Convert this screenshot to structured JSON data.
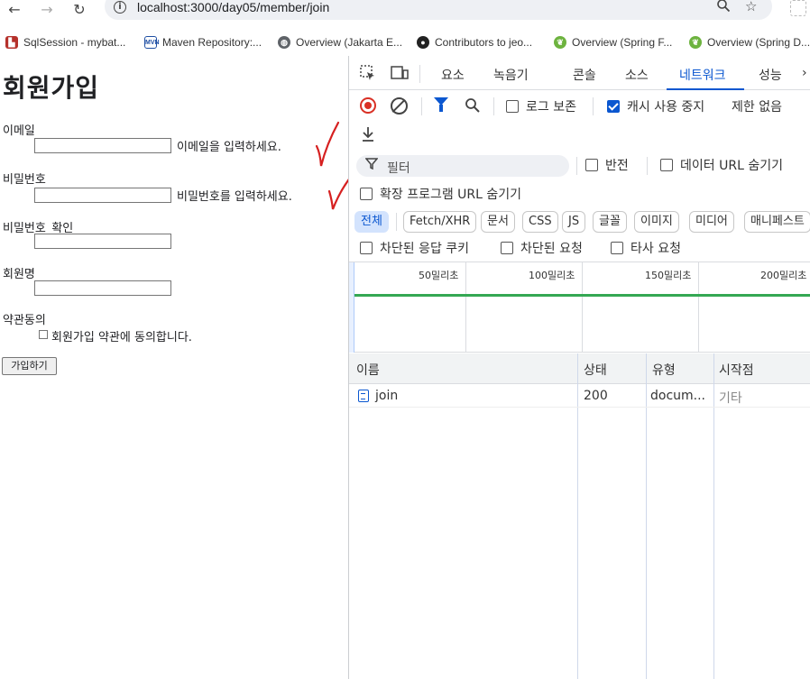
{
  "browser": {
    "url": "localhost:3000/day05/member/join",
    "bookmarks": [
      {
        "label": "SqlSession - mybat...",
        "icon": "mybatis-icon"
      },
      {
        "label": "Maven Repository:...",
        "icon": "maven-icon"
      },
      {
        "label": "Overview (Jakarta E...",
        "icon": "globe-icon"
      },
      {
        "label": "Contributors to jeo...",
        "icon": "github-icon"
      },
      {
        "label": "Overview (Spring F...",
        "icon": "spring-icon"
      },
      {
        "label": "Overview (Spring D...",
        "icon": "spring-icon"
      }
    ]
  },
  "form": {
    "title": "회원가입",
    "email_label": "이메일",
    "email_value": "",
    "email_hint": "이메일을 입력하세요.",
    "password_label": "비밀번호",
    "password_value": "",
    "password_hint": "비밀번호를 입력하세요.",
    "password_confirm_label": "비밀번호_확인",
    "password_confirm_value": "",
    "name_label": "회원명",
    "name_value": "",
    "terms_label": "약관동의",
    "terms_checkbox_label": "회원가입 약관에 동의합니다.",
    "terms_checked": false,
    "submit_label": "가입하기"
  },
  "devtools": {
    "tabs": [
      "요소",
      "녹음기",
      "콘솔",
      "소스",
      "네트워크",
      "성능"
    ],
    "active_tab": "네트워크",
    "toolbar": {
      "preserve_log": "로그 보존",
      "preserve_log_checked": false,
      "disable_cache": "캐시 사용 중지",
      "disable_cache_checked": true,
      "throttling": "제한 없음"
    },
    "filter": {
      "placeholder": "필터",
      "invert": "반전",
      "invert_checked": false,
      "hide_data_urls": "데이터 URL 숨기기",
      "hide_data_urls_checked": false,
      "hide_extension_urls": "확장 프로그램 URL 숨기기",
      "hide_extension_urls_checked": false
    },
    "type_filters": [
      "전체",
      "Fetch/XHR",
      "문서",
      "CSS",
      "JS",
      "글꼴",
      "이미지",
      "미디어",
      "매니페스트"
    ],
    "active_type_filter": "전체",
    "more_filters": {
      "blocked_cookies": "차단된 응답 쿠키",
      "blocked_requests": "차단된 요청",
      "third_party": "타사 요청"
    },
    "timeline_labels": [
      "50밀리초",
      "100밀리초",
      "150밀리초",
      "200밀리초"
    ],
    "columns": [
      "이름",
      "상태",
      "유형",
      "시작점"
    ],
    "rows": [
      {
        "name": "join",
        "status": "200",
        "type": "docum...",
        "initiator": "기타"
      }
    ]
  },
  "colors": {
    "accent": "#0b57d0",
    "record": "#d93025",
    "timeline_bar": "#34a853",
    "annotation": "#d62020"
  }
}
